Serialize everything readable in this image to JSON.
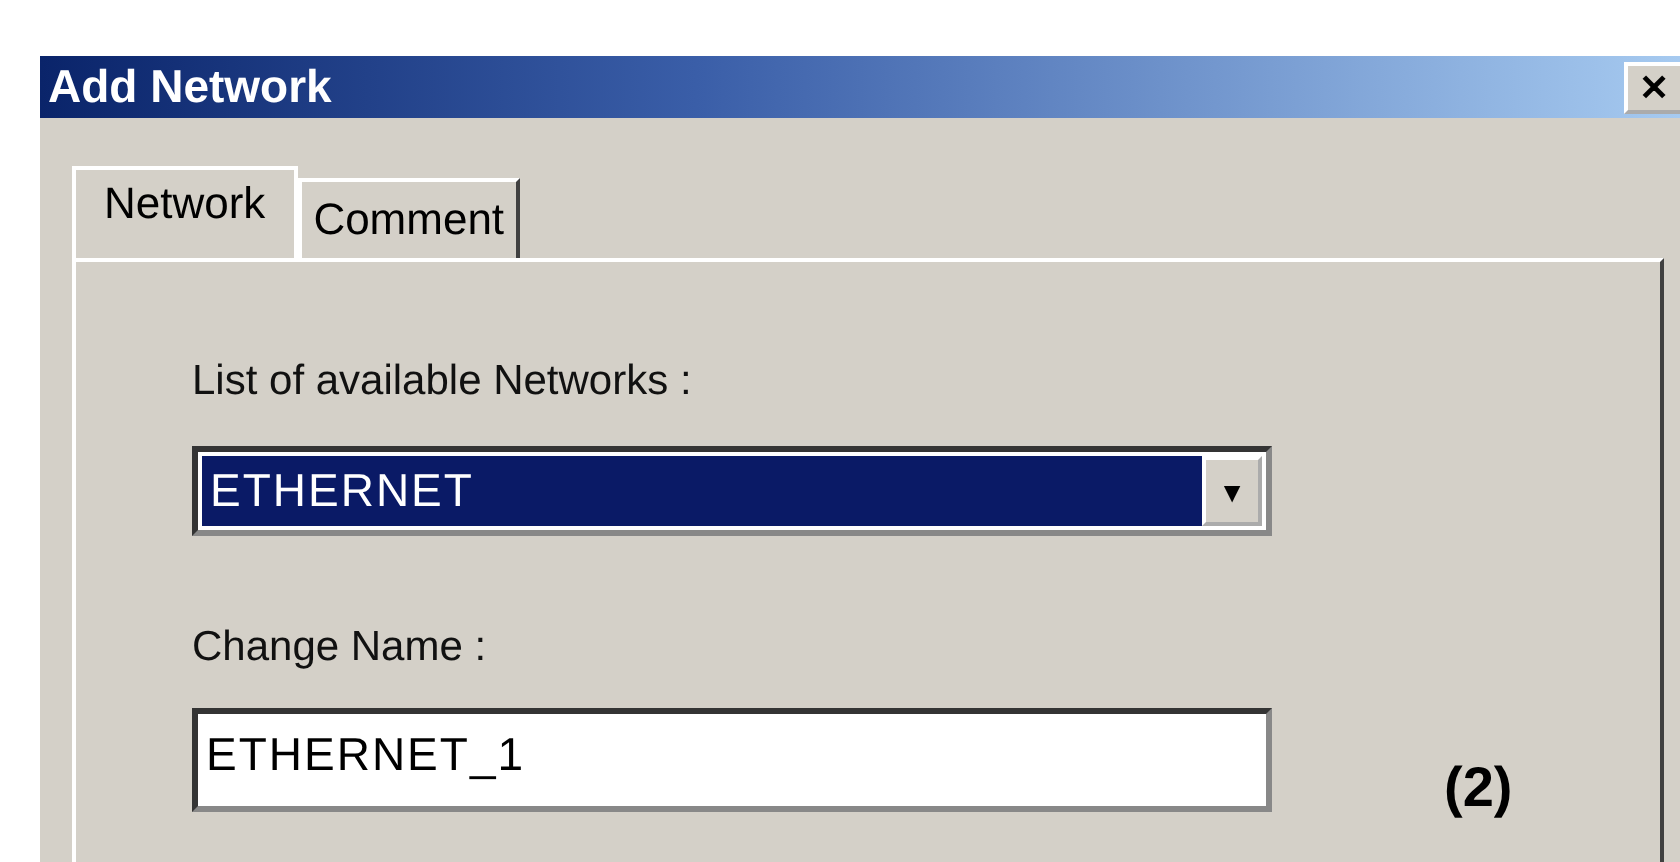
{
  "window": {
    "title": "Add Network",
    "close": "✕"
  },
  "tabs": [
    {
      "label": "Network",
      "selected": true
    },
    {
      "label": "Comment",
      "selected": false
    }
  ],
  "network_list": {
    "label": "List of available Networks :",
    "value": "ETHERNET",
    "arrow": "▼"
  },
  "change_name": {
    "label": "Change Name :",
    "value": "ETHERNET_1"
  },
  "annotation": "(2)"
}
